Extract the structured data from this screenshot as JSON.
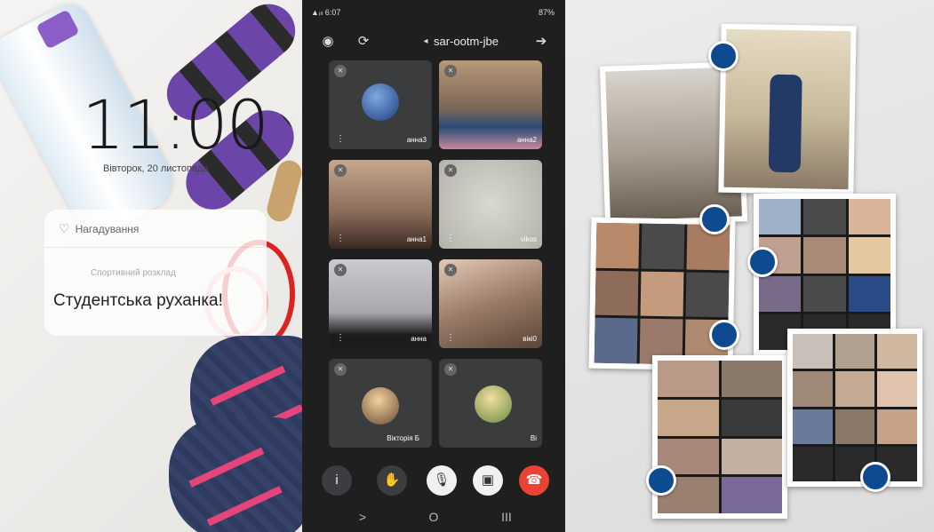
{
  "lockscreen": {
    "time": "11:00",
    "date": "Вівторок, 20 листопада",
    "notification": {
      "app": "Нагадування",
      "subtitle": "Спортивний розклад",
      "title": "Студентська руханка!"
    }
  },
  "phone": {
    "status_left": "▲ᵢₗₗ 6:07",
    "status_right": "87%",
    "meeting_code": "sar-ootm-jbe",
    "participants": [
      {
        "name": "анна3",
        "has_avatar": true
      },
      {
        "name": "анна2",
        "has_avatar": false
      },
      {
        "name": "анна1",
        "has_avatar": false
      },
      {
        "name": "vikos",
        "has_avatar": false
      },
      {
        "name": "анна",
        "has_avatar": false
      },
      {
        "name": "вікі0",
        "has_avatar": false
      },
      {
        "name": "Вікторія Б",
        "has_avatar": true
      },
      {
        "name": "Ві",
        "has_avatar": true
      }
    ],
    "controls": [
      "info",
      "raise-hand",
      "mic-off",
      "camera-off",
      "end-call"
    ],
    "nav": [
      ">",
      "O",
      "III"
    ]
  },
  "collage": {
    "accent": "#0e4a8f"
  },
  "colors": {
    "end_call": "#ea4335",
    "phone_bg": "#1f1f20",
    "tile_bg": "#3b3c3e"
  }
}
